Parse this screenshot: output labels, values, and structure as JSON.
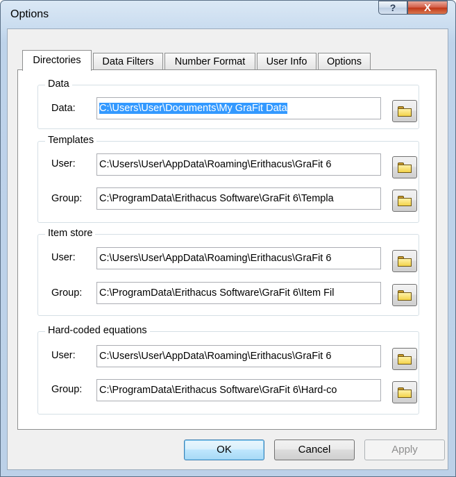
{
  "window": {
    "title": "Options",
    "help_glyph": "?",
    "close_glyph": "X"
  },
  "tabs": [
    {
      "label": "Directories",
      "active": true
    },
    {
      "label": "Data Filters"
    },
    {
      "label": "Number Format"
    },
    {
      "label": "User Info"
    },
    {
      "label": "Options"
    }
  ],
  "groups": {
    "data": {
      "title": "Data",
      "rows": [
        {
          "label": "Data:",
          "value": "C:\\Users\\User\\Documents\\My GraFit Data"
        }
      ]
    },
    "templates": {
      "title": "Templates",
      "rows": [
        {
          "label": "User:",
          "value": "C:\\Users\\User\\AppData\\Roaming\\Erithacus\\GraFit 6"
        },
        {
          "label": "Group:",
          "value": "C:\\ProgramData\\Erithacus Software\\GraFit 6\\Templa"
        }
      ]
    },
    "item_store": {
      "title": "Item store",
      "rows": [
        {
          "label": "User:",
          "value": "C:\\Users\\User\\AppData\\Roaming\\Erithacus\\GraFit 6"
        },
        {
          "label": "Group:",
          "value": "C:\\ProgramData\\Erithacus Software\\GraFit 6\\Item Fil"
        }
      ]
    },
    "hard_coded": {
      "title": "Hard-coded equations",
      "rows": [
        {
          "label": "User:",
          "value": "C:\\Users\\User\\AppData\\Roaming\\Erithacus\\GraFit 6"
        },
        {
          "label": "Group:",
          "value": "C:\\ProgramData\\Erithacus Software\\GraFit 6\\Hard-co"
        }
      ]
    }
  },
  "buttons": {
    "ok": "OK",
    "cancel": "Cancel",
    "apply": "Apply"
  },
  "icons": {
    "browse": "folder-icon"
  }
}
